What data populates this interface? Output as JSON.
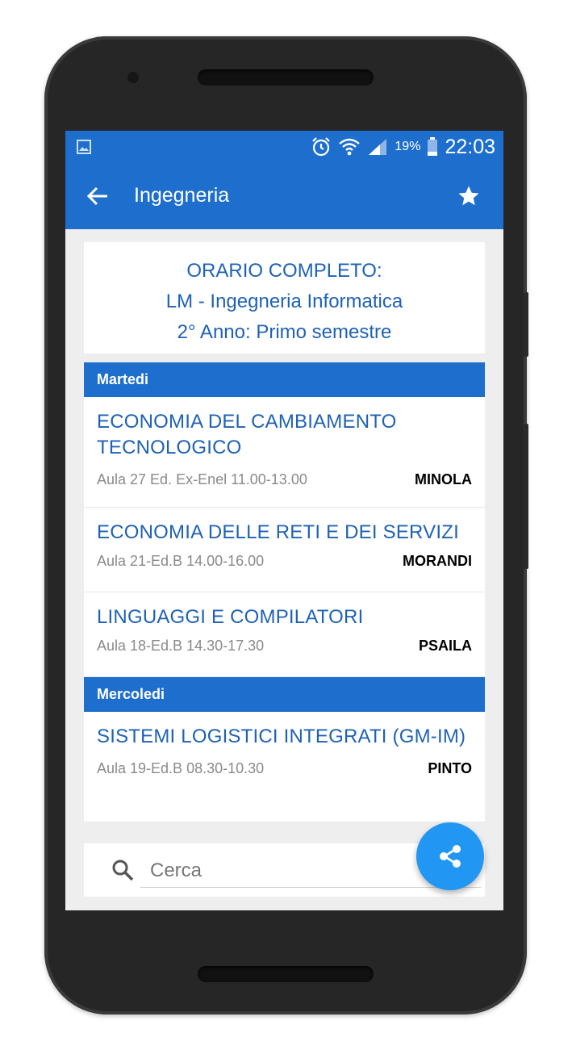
{
  "status_bar": {
    "battery_percent": "19%",
    "time": "22:03",
    "icons": [
      "image-icon",
      "alarm-icon",
      "wifi-icon",
      "signal-icon",
      "battery-icon"
    ]
  },
  "app_bar": {
    "title": "Ingegneria",
    "back_icon": "arrow-back-icon",
    "favorite_icon": "star-icon"
  },
  "header": {
    "line1": "ORARIO COMPLETO:",
    "line2": "LM - Ingegneria Informatica",
    "line3": "2° Anno: Primo semestre"
  },
  "days": [
    {
      "name": "Martedi",
      "courses": [
        {
          "name": "ECONOMIA DEL CAMBIAMENTO TECNOLOGICO",
          "room": "Aula 27 Ed. Ex-Enel 11.00-13.00",
          "professor": "MINOLA"
        },
        {
          "name": "ECONOMIA DELLE RETI E DEI SERVIZI",
          "room": "Aula 21-Ed.B 14.00-16.00",
          "professor": "MORANDI"
        },
        {
          "name": "LINGUAGGI E COMPILATORI",
          "room": "Aula 18-Ed.B 14.30-17.30",
          "professor": "PSAILA"
        }
      ]
    },
    {
      "name": "Mercoledi",
      "courses": [
        {
          "name": "SISTEMI LOGISTICI INTEGRATI (GM-IM)",
          "room": "Aula 19-Ed.B 08.30-10.30",
          "professor": "PINTO"
        }
      ]
    }
  ],
  "search": {
    "placeholder": "Cerca",
    "icon": "search-icon"
  },
  "fab": {
    "icon": "share-icon"
  },
  "colors": {
    "primary": "#1e6fcd",
    "text_blue": "#1e62b6",
    "fab": "#2196f3"
  }
}
